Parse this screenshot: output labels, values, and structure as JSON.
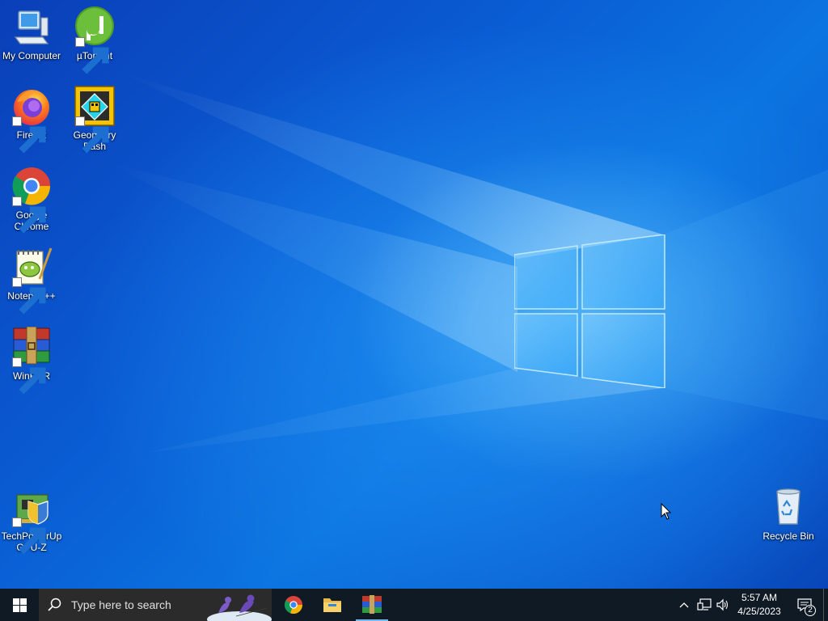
{
  "desktop": {
    "icons": [
      {
        "label": "My Computer",
        "icon": "my-computer-icon"
      },
      {
        "label": "µTorrent",
        "icon": "utorrent-icon"
      },
      {
        "label": "Firefox",
        "icon": "firefox-icon"
      },
      {
        "label": "Geometry Dash",
        "icon": "geometry-dash-icon"
      },
      {
        "label": "Google Chrome",
        "icon": "google-chrome-icon"
      },
      {
        "label": "Notepad++",
        "icon": "notepad-plus-plus-icon"
      },
      {
        "label": "WinRAR",
        "icon": "winrar-icon"
      },
      {
        "label": "TechPowerUp GPU-Z",
        "icon": "gpu-z-icon"
      },
      {
        "label": "Recycle Bin",
        "icon": "recycle-bin-icon"
      }
    ]
  },
  "taskbar": {
    "search_placeholder": "Type here to search",
    "pinned_apps": [
      "Google Chrome",
      "File Explorer",
      "WinRAR"
    ],
    "active_app": "WinRAR",
    "clock": {
      "time": "5:57 AM",
      "date": "4/25/2023"
    },
    "notifications_count": "2",
    "accent_color": "#76b9ed",
    "background_color": "#101a24"
  }
}
